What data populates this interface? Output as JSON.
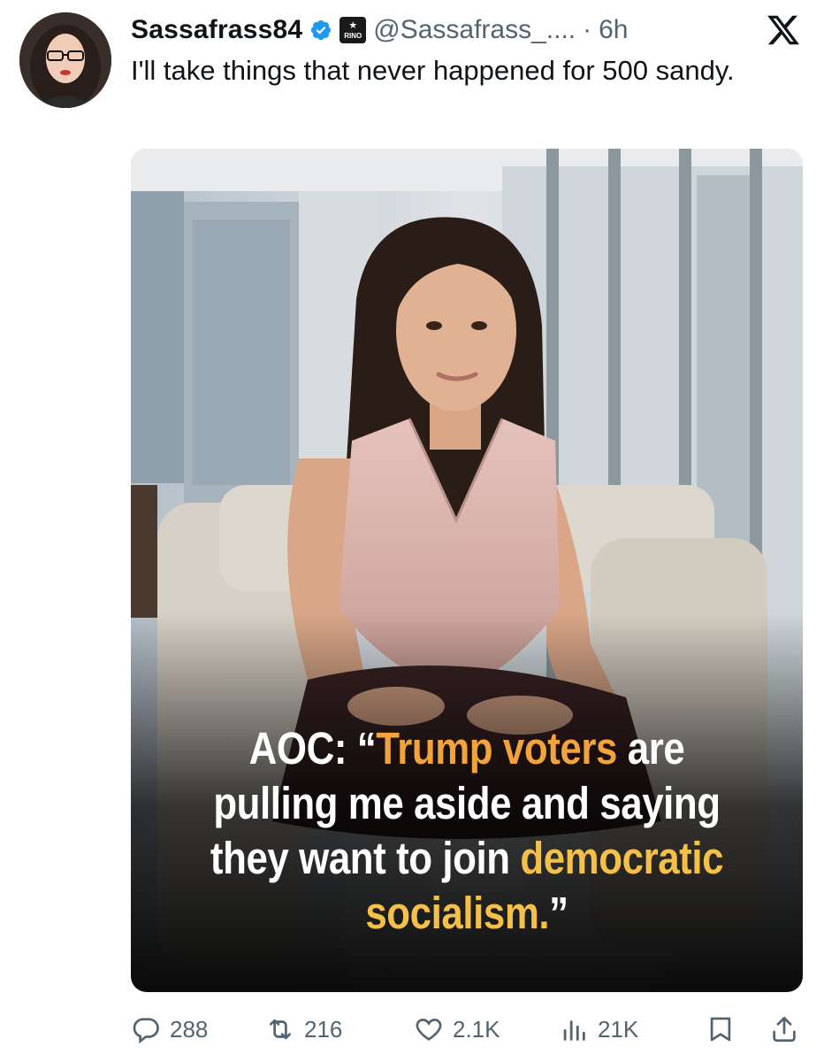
{
  "author": {
    "display_name": "Sassafrass84",
    "handle": "@Sassafrass_....",
    "separator": "·",
    "time": "6h",
    "affiliation_badge": "RINO"
  },
  "tweet": {
    "text": "I'll take things that never happened for 500 sandy."
  },
  "media": {
    "caption_prefix": "AOC: “",
    "caption_hl1": "Trump voters",
    "caption_mid": " are pulling me aside and saying they want to join ",
    "caption_hl2": "democratic socialism.",
    "caption_suffix": "”"
  },
  "actions": {
    "replies": "288",
    "reposts": "216",
    "likes": "2.1K",
    "views": "21K"
  },
  "colors": {
    "verified": "#1d9bf0",
    "text": "#0f1419",
    "muted": "#536471",
    "caption_highlight_1": "#f2a33c",
    "caption_highlight_2": "#f5c04a"
  },
  "icons": [
    "verified-icon",
    "x-logo-icon",
    "reply-icon",
    "repost-icon",
    "like-icon",
    "views-icon",
    "bookmark-icon",
    "share-icon"
  ]
}
